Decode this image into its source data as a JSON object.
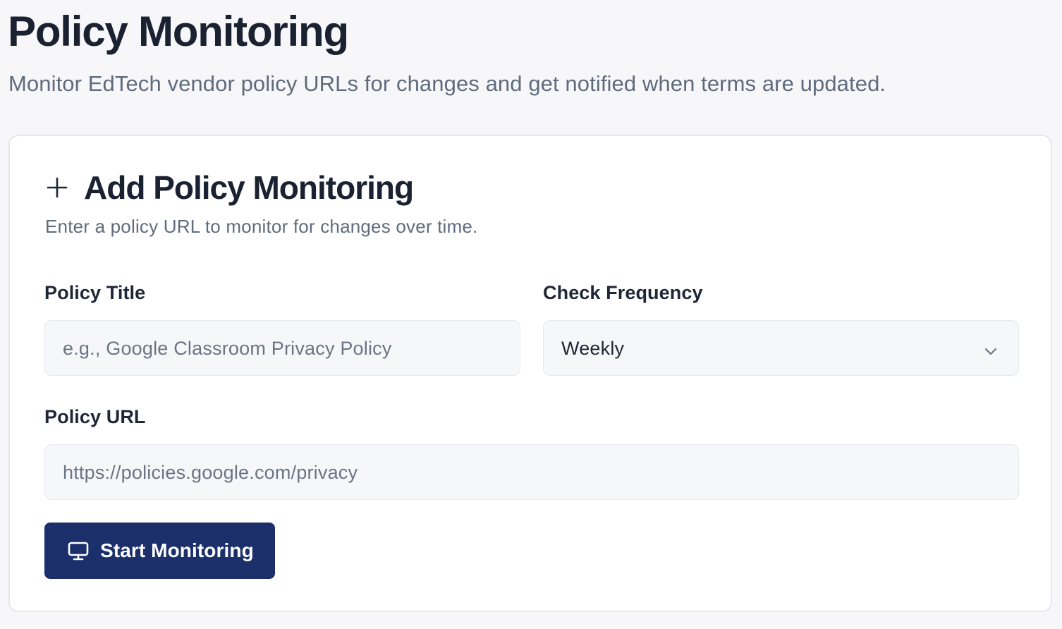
{
  "page": {
    "title": "Policy Monitoring",
    "subtitle": "Monitor EdTech vendor policy URLs for changes and get notified when terms are updated."
  },
  "card": {
    "icon": "plus-icon",
    "title": "Add Policy Monitoring",
    "subtitle": "Enter a policy URL to monitor for changes over time."
  },
  "form": {
    "policy_title": {
      "label": "Policy Title",
      "value": "",
      "placeholder": "e.g., Google Classroom Privacy Policy"
    },
    "check_frequency": {
      "label": "Check Frequency",
      "selected": "Weekly",
      "icon": "chevron-down-icon"
    },
    "policy_url": {
      "label": "Policy URL",
      "value": "",
      "placeholder": "https://policies.google.com/privacy"
    },
    "submit": {
      "label": "Start Monitoring",
      "icon": "monitor-icon"
    }
  },
  "colors": {
    "background": "#f7f7f9",
    "card": "#ffffff",
    "primary_button": "#1b2f6b",
    "title_text": "#1a2130",
    "muted_text": "#5f6b7d",
    "input_background": "#f6f7f9"
  }
}
